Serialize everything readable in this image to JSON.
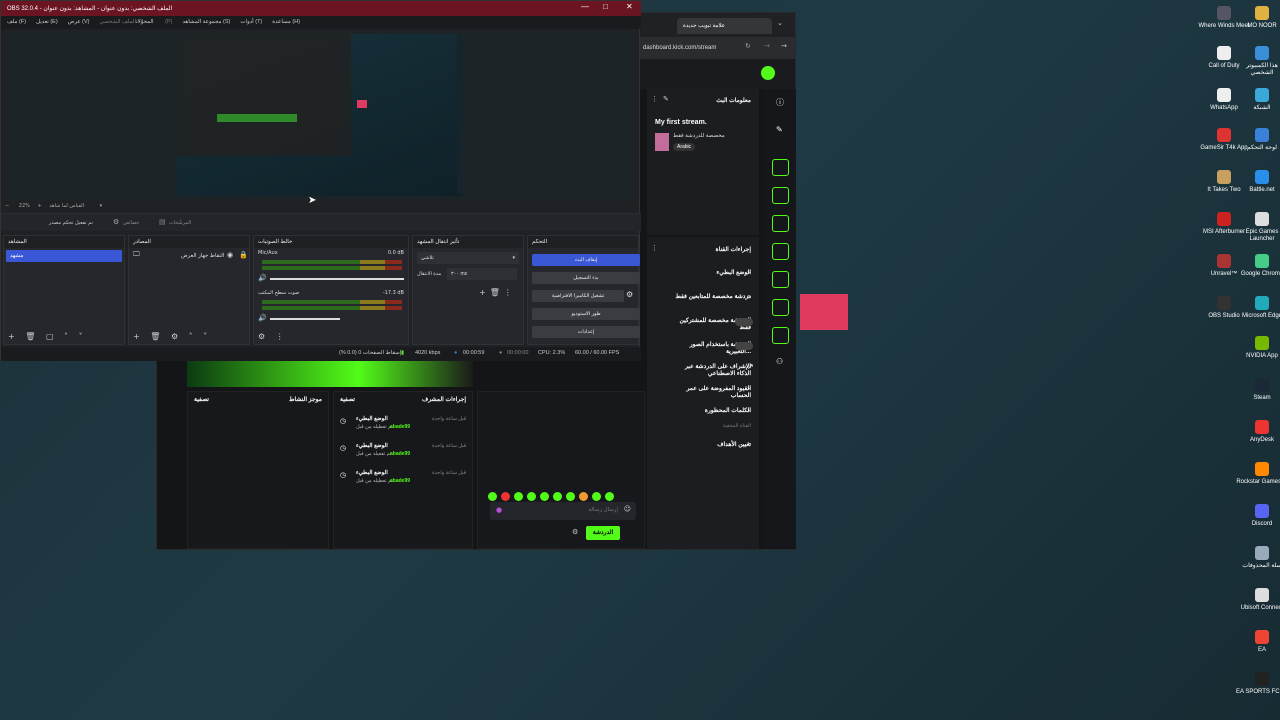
{
  "obs": {
    "title": "OBS 32.0.4 - الملف الشخصي: بدون عنوان - المشاهد: بدون عنوان",
    "menu": [
      "ملف (F)",
      "تعديل (E)",
      "عرض (V)",
      "المحوّلات",
      "الملف الشخصي (P)",
      "مجموعة المشاهد (S)",
      "أدوات (T)",
      "مساعدة (H)"
    ],
    "zoom": "22%",
    "zoom_label": "القياس لما شاهد",
    "studio_mode": "تم تفعيل تحكم مصدر",
    "settings_btn": "خصائص",
    "filters_btn": "المرشّحات",
    "docks": {
      "scenes": {
        "title": "المشاهد",
        "items": [
          "مشهد"
        ]
      },
      "sources": {
        "title": "المصادر",
        "items": [
          "التقاط جهاز العرض"
        ]
      },
      "mixer": {
        "title": "خالط الصوتيات",
        "tracks": [
          {
            "name": "Mic/Aux",
            "db": "0.0 dB"
          },
          {
            "name": "صوت سطح المكتب",
            "db": "-17.3 dB"
          }
        ]
      },
      "transitions": {
        "title": "تأثير انتقال المشهد",
        "type": "تلاشي",
        "duration_label": "مدة الانتقال",
        "duration": "٣٠٠ ms"
      },
      "controls": {
        "title": "التحكم",
        "buttons": [
          "إيقاف البث",
          "بدء التسجيل",
          "تشغيل الكاميرا الافتراضية",
          "طور الاستوديو",
          "إعدادات"
        ]
      }
    },
    "status": {
      "dropped": "إسقاط الصفحات 0 (0.0 %)",
      "bitrate": "4020 kbps",
      "stream_time": "00:00:59",
      "rec_time": "00:00:00",
      "cpu": "CPU: 2.3%",
      "fps": "60.00 / 60.00 FPS"
    }
  },
  "browser": {
    "tab_title": "علامة تبويب جديدة",
    "url": "dashboard.kick.com/stream",
    "stream_info": {
      "header": "معلومات البث",
      "title": "My first stream.",
      "category": "مخصصة للدردشة فقط",
      "language": "Arabic"
    },
    "channel_actions": {
      "header": "إجراءات القناة",
      "items": [
        "الوضع البطيء",
        "دردشة مخصصة للمتابعين فقط",
        "الدردشة مخصصة للمشتركين فقط",
        "الدردشة باستخدام الصور التعبيرية...",
        "الإشراف على الدردشة عبر الذكاء الاصطناعي",
        "القيود المفروضة على عمر الحساب",
        "الكلمات المحظورة"
      ],
      "hidden_label": "القناة المخفية",
      "goals": "تعيين الأهداف"
    },
    "mod_actions": {
      "header": "إجراءات المشرف",
      "filter": "تصفية",
      "events": [
        {
          "title": "الوضع البطيء",
          "sub": "تم تعطيله من قبل",
          "user": "abade99",
          "time": "قبل ساعة واحدة"
        },
        {
          "title": "الوضع البطيء",
          "sub": "تم تفعيله من قبل",
          "user": "abade99",
          "time": "قبل ساعة واحدة"
        },
        {
          "title": "الوضع البطيء",
          "sub": "تم تعطيله من قبل",
          "user": "abade99",
          "time": "قبل ساعة واحدة"
        }
      ]
    },
    "activity": {
      "header": "موجز النشاط",
      "filter": "تصفية"
    },
    "chat": {
      "placeholder": "إرسال رسالة",
      "send": "الدردشة"
    }
  },
  "desktop_icons": [
    {
      "label": "Where Winds Meet",
      "color": "#556"
    },
    {
      "label": "MO NOOR",
      "color": "#e0b040"
    },
    {
      "label": "Call of Duty",
      "color": "#eee"
    },
    {
      "label": "هذا الكمبيوتر الشخصي",
      "color": "#3a8fd8"
    },
    {
      "label": "WhatsApp",
      "color": "#eee"
    },
    {
      "label": "الشبكة",
      "color": "#3aa8d8"
    },
    {
      "label": "GameSir T4k App",
      "color": "#d33"
    },
    {
      "label": "لوحة التحكم",
      "color": "#3a7fd8"
    },
    {
      "label": "It Takes Two",
      "color": "#c8a060"
    },
    {
      "label": "Battle.net",
      "color": "#2a8fe8"
    },
    {
      "label": "MSI Afterburner",
      "color": "#c22"
    },
    {
      "label": "Epic Games Launcher",
      "color": "#ddd"
    },
    {
      "label": "Unravel™",
      "color": "#a33"
    },
    {
      "label": "Google Chrome",
      "color": "#4c8"
    },
    {
      "label": "OBS Studio",
      "color": "#333"
    },
    {
      "label": "Microsoft Edge",
      "color": "#2ab"
    },
    {
      "label": "NVIDIA App",
      "color": "#76b900"
    },
    {
      "label": "Steam",
      "color": "#1b2838"
    },
    {
      "label": "AnyDesk",
      "color": "#e33"
    },
    {
      "label": "Rockstar Games ...",
      "color": "#f80"
    },
    {
      "label": "Discord",
      "color": "#5865f2"
    },
    {
      "label": "سلة المحذوفات",
      "color": "#9ab"
    },
    {
      "label": "Ubisoft Connect",
      "color": "#ddd"
    },
    {
      "label": "EA",
      "color": "#e43"
    },
    {
      "label": "EA SPORTS FC 26",
      "color": "#222"
    }
  ]
}
